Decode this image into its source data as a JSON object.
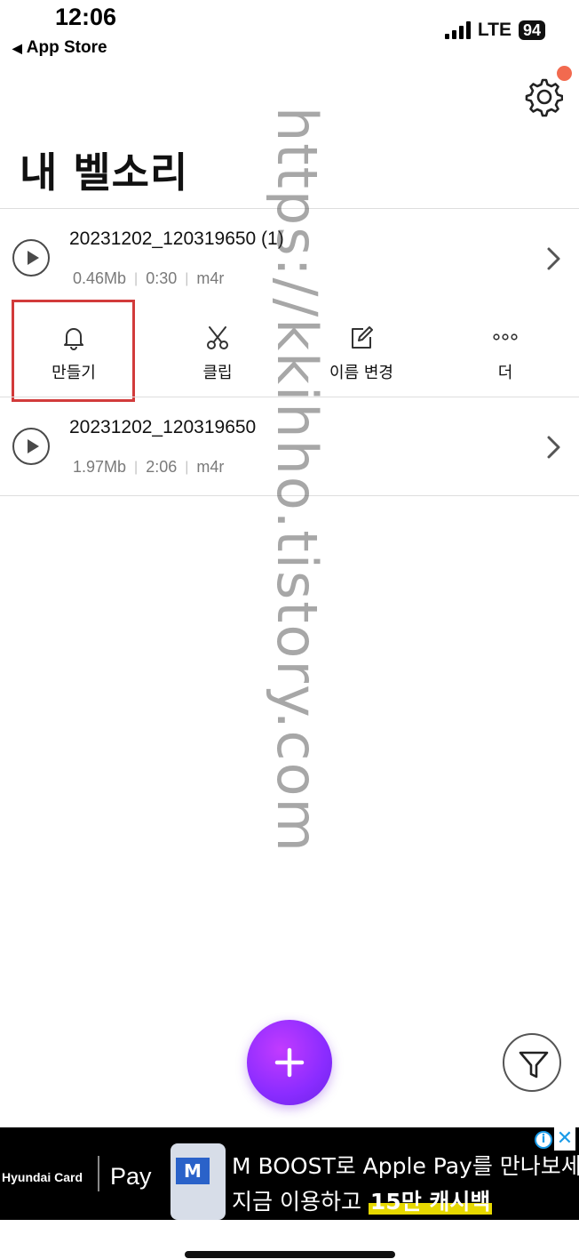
{
  "status_bar": {
    "time": "12:06",
    "back_label": "App Store",
    "network": "LTE",
    "battery": "94"
  },
  "header": {
    "title": "내 벨소리",
    "settings_icon": "gear-icon",
    "notification_color": "#f26a4f"
  },
  "files": [
    {
      "name": "20231202_120319650 (1)",
      "size": "0.46Mb",
      "duration": "0:30",
      "format": "m4r"
    },
    {
      "name": "20231202_120319650",
      "size": "1.97Mb",
      "duration": "2:06",
      "format": "m4r"
    }
  ],
  "actions": [
    {
      "label": "만들기",
      "icon": "bell-icon"
    },
    {
      "label": "클립",
      "icon": "scissors-icon"
    },
    {
      "label": "이름 변경",
      "icon": "edit-icon"
    },
    {
      "label": "더",
      "icon": "more-icon"
    }
  ],
  "fab": {
    "icon": "plus-icon"
  },
  "filter": {
    "icon": "filter-icon"
  },
  "watermark": "https://kkihho.tistory.com",
  "ad": {
    "brand1": "Hyundai Card",
    "brand2": "Pay",
    "card_letter": "M",
    "line1": "M BOOST로 Apple Pay를 만나보세요",
    "line2_prefix": "지금 이용하고 ",
    "line2_highlight": "15만 캐시백"
  },
  "colors": {
    "highlight_box": "#d23b3b",
    "fab_purple": "#8a2cff",
    "ad_blue": "#1a9be8"
  }
}
